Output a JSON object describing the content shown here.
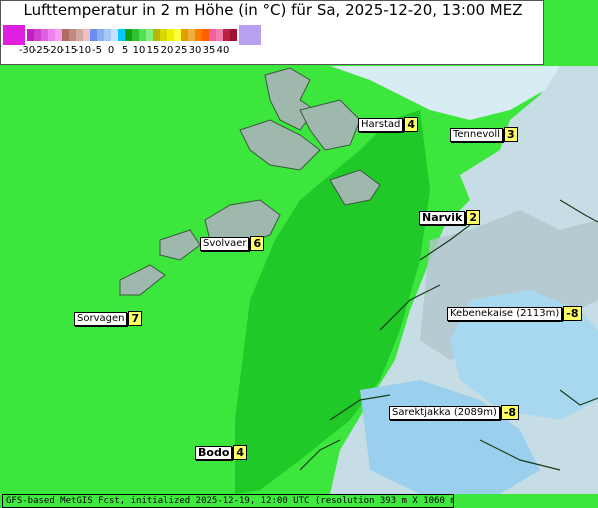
{
  "title": "Lufttemperatur in 2 m Höhe (in °C) für Sa, 2025-12-20, 13:00 MEZ",
  "legend": {
    "ticks": [
      "-30",
      "-25",
      "-20",
      "-15",
      "-10",
      "-5",
      "0",
      "5",
      "10",
      "15",
      "20",
      "25",
      "30",
      "35",
      "40"
    ],
    "colors": {
      "end_low": "#e020e0",
      "end_high": "#b8a0f0",
      "bands": [
        "#c020c0",
        "#d040d0",
        "#e060e0",
        "#f080f0",
        "#f0a0f0",
        "#b06a60",
        "#c08a80",
        "#d0aaa0",
        "#f0c0c0",
        "#6a8ff0",
        "#8aaff0",
        "#a8c8f8",
        "#c8e0ff",
        "#00c8ff",
        "#10a010",
        "#30c030",
        "#50e050",
        "#80f080",
        "#b8b800",
        "#d8d800",
        "#f0f000",
        "#ffff40",
        "#e0a000",
        "#f0b040",
        "#ff8000",
        "#ff6000",
        "#f060a0",
        "#f080b0",
        "#c02040",
        "#a01030"
      ]
    }
  },
  "places": [
    {
      "name": "Harstad",
      "temp": "4",
      "bold": false
    },
    {
      "name": "Tennevoll",
      "temp": "3",
      "bold": false
    },
    {
      "name": "Narvik",
      "temp": "2",
      "bold": true
    },
    {
      "name": "Svolvaer",
      "temp": "6",
      "bold": false
    },
    {
      "name": "Sorvagen",
      "temp": "7",
      "bold": false
    },
    {
      "name": "Kebenekaise (2113m)",
      "temp": "-8",
      "bold": false
    },
    {
      "name": "Sarektjakka (2089m)",
      "temp": "-8",
      "bold": false
    },
    {
      "name": "Bodo",
      "temp": "4",
      "bold": true
    }
  ],
  "footer": "GFS-based MetGIS Fcst, initialized 2025-12-19, 12:00 UTC  (resolution 393 m X 1060 m)",
  "map_colors": {
    "sea": "#3ce63c",
    "lowland": "#28d028",
    "valley": "#20b020",
    "snow": "#c8e8f8",
    "ice": "#a8d8f0",
    "rock": "#b8c8c8"
  }
}
